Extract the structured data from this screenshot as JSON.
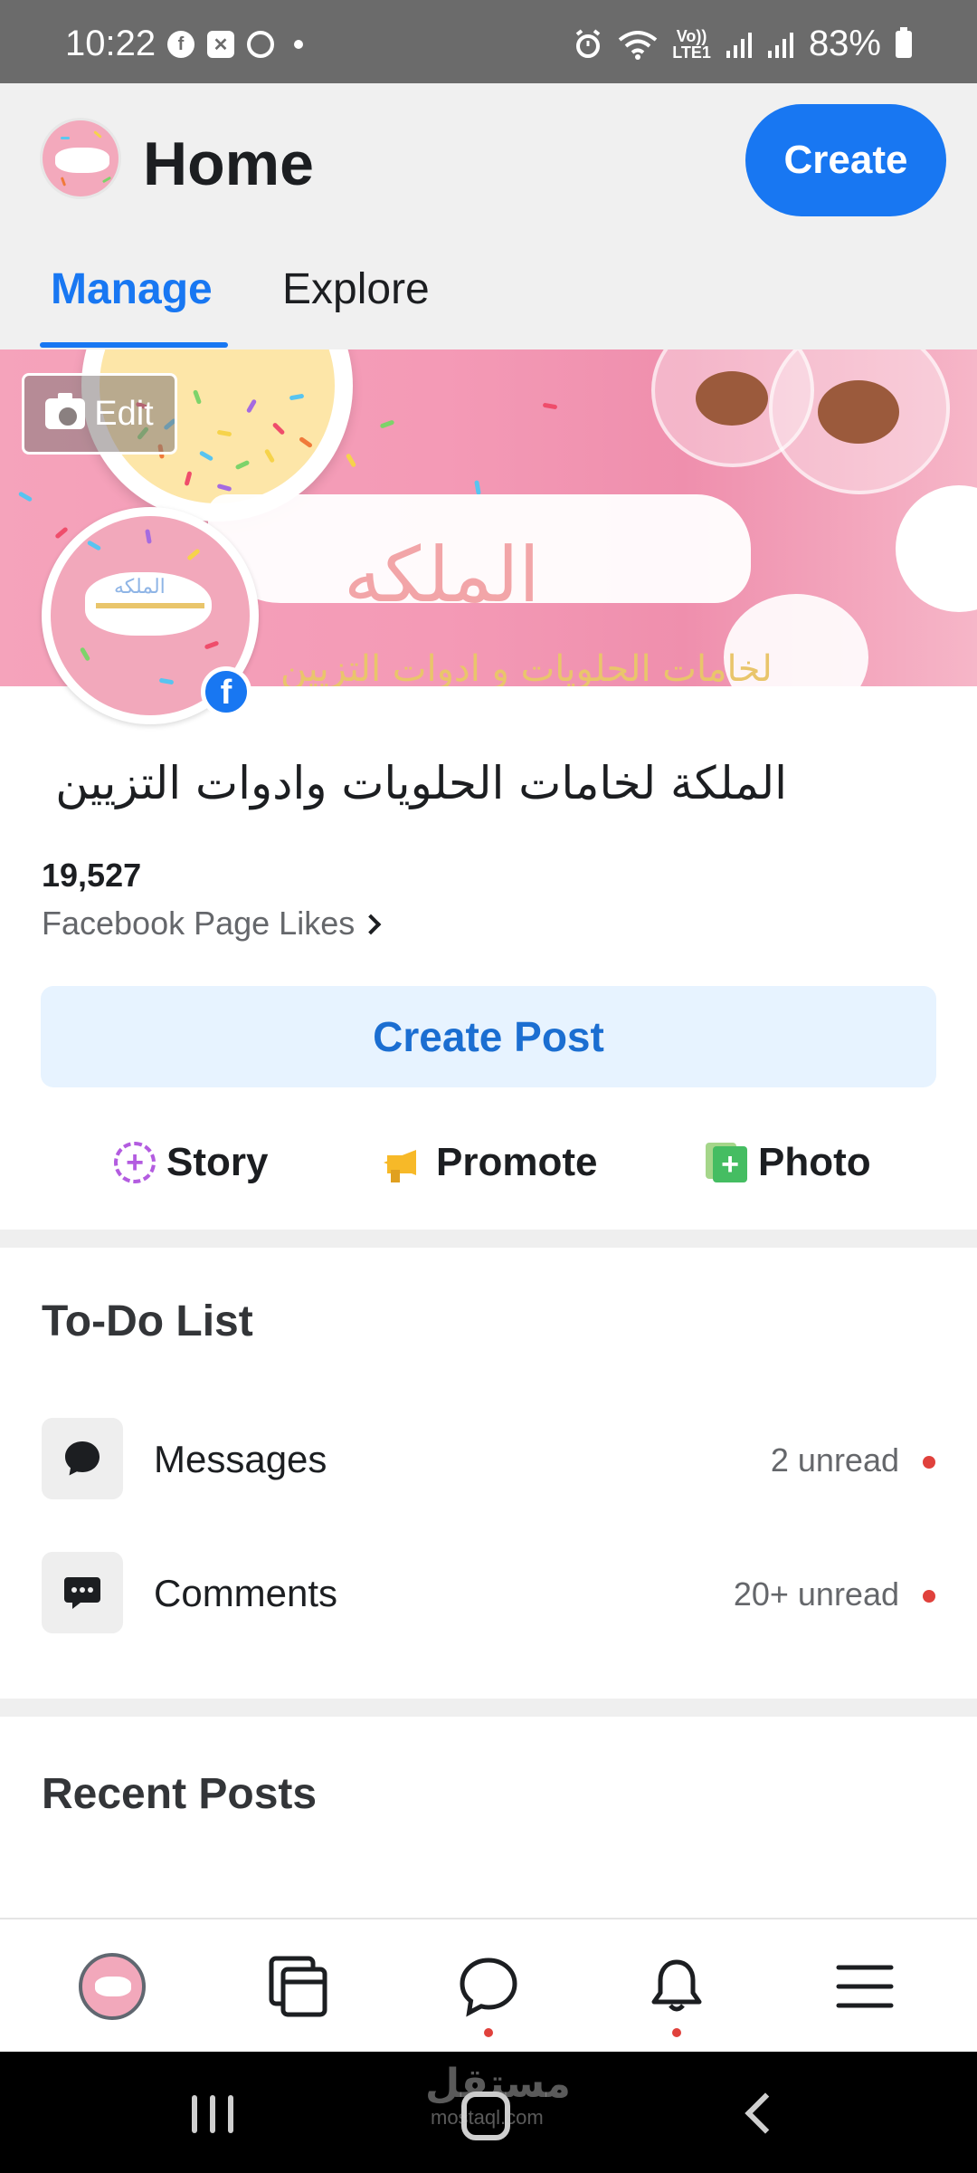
{
  "status_bar": {
    "time": "10:22",
    "battery": "83%",
    "volte_top": "Vo))",
    "volte_bottom": "LTE1"
  },
  "header": {
    "title": "Home",
    "create_label": "Create",
    "tabs": [
      {
        "label": "Manage",
        "active": true
      },
      {
        "label": "Explore",
        "active": false
      }
    ]
  },
  "cover": {
    "edit_label": "Edit",
    "title": "الملكه",
    "subtitle": "لخامات الحلويات و ادوات التزيين"
  },
  "profile": {
    "logo_text": "الملكه",
    "badge": "f"
  },
  "page": {
    "name": "الملكة لخامات الحلويات وادوات التزيين",
    "likes_count": "19,527",
    "likes_label": "Facebook Page Likes",
    "create_post_label": "Create Post"
  },
  "actions": [
    {
      "label": "Story",
      "icon": "story-plus-icon"
    },
    {
      "label": "Promote",
      "icon": "megaphone-icon"
    },
    {
      "label": "Photo",
      "icon": "photo-plus-icon"
    }
  ],
  "todo": {
    "title": "To-Do List",
    "items": [
      {
        "label": "Messages",
        "count": "2 unread",
        "icon": "chat-bubble-icon"
      },
      {
        "label": "Comments",
        "count": "20+ unread",
        "icon": "comment-dots-icon"
      }
    ]
  },
  "recent_posts": {
    "title": "Recent Posts"
  },
  "bottom_nav": {
    "items": [
      "page-avatar",
      "pages-feed-icon",
      "messenger-icon",
      "bell-icon",
      "menu-icon"
    ]
  },
  "watermark": {
    "text": "مستقل",
    "sub": "mostaql.com"
  },
  "colors": {
    "accent": "#1877f2",
    "create_post_bg": "#e7f3ff",
    "unread_dot": "#e0413c",
    "status_bar": "#6b6b6b"
  }
}
